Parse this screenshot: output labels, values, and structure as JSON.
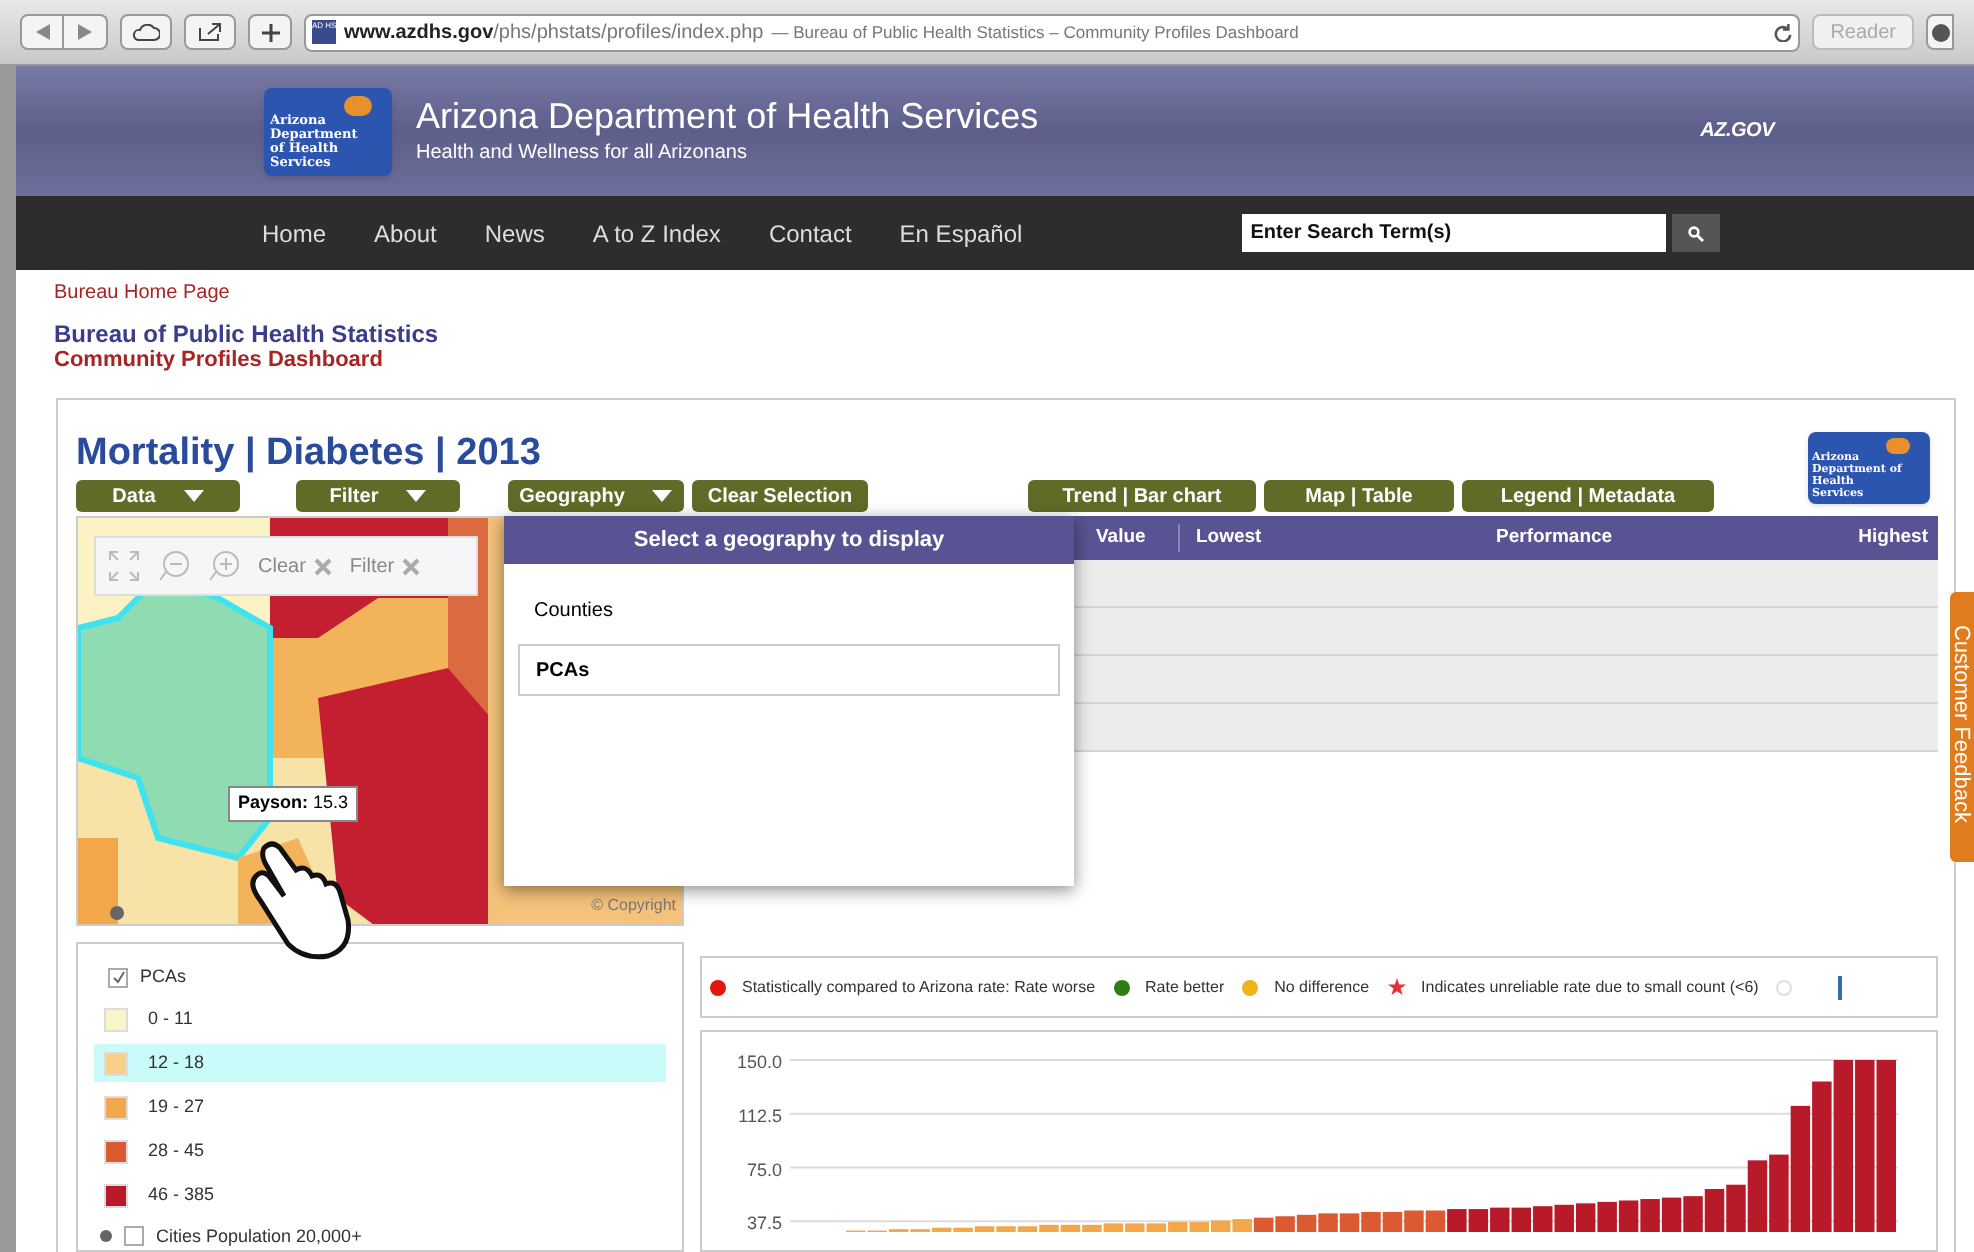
{
  "browser": {
    "url_host": "www.azdhs.gov",
    "url_path": "/phs/phstats/profiles/index.php",
    "page_title": "— Bureau of Public Health Statistics – Community Profiles Dashboard",
    "favicon": "AD HS",
    "reader": "Reader"
  },
  "header": {
    "logo_text": "Arizona Department of Health Services",
    "title": "Arizona Department of Health Services",
    "subtitle": "Health and Wellness for all Arizonans",
    "az_logo": "AZ.GOV"
  },
  "nav": {
    "items": [
      "Home",
      "About",
      "News",
      "A to Z Index",
      "Contact",
      "En Español"
    ],
    "search": {
      "placeholder": "Enter Search Term(s)"
    }
  },
  "breadcrumb": "Bureau Home Page",
  "bureau_title": "Bureau of Public Health Statistics",
  "dashboard_title": "Community Profiles Dashboard",
  "page_heading": "Mortality | Diabetes | 2013",
  "logo_small": "Arizona Department of Health Services",
  "left_buttons": [
    {
      "label": "Data",
      "kind": "dropdown"
    },
    {
      "label": "Filter",
      "kind": "dropdown"
    },
    {
      "label": "Geography",
      "kind": "dropdown"
    },
    {
      "label": "Clear Selection",
      "kind": "plain"
    }
  ],
  "right_buttons": [
    "Trend | Bar chart",
    "Map | Table",
    "Legend | Metadata"
  ],
  "map_tools": {
    "clear": "Clear",
    "filter": "Filter",
    "copyright": "© Copyright",
    "tooltip_name": "Payson:",
    "tooltip_value": "15.3"
  },
  "geography_panel": {
    "title": "Select a geography to display",
    "options": [
      {
        "label": "Counties",
        "selected": false
      },
      {
        "label": "PCAs",
        "selected": true
      }
    ]
  },
  "table": {
    "columns": [
      "Value",
      "Lowest",
      "Performance",
      "Highest"
    ]
  },
  "layer_legend": {
    "layer": {
      "label": "PCAs",
      "checked": true
    },
    "items": [
      {
        "label": "0 - 11",
        "color": "#fbf6c8",
        "selected": false
      },
      {
        "label": "12 - 18",
        "color": "#f7cf86",
        "selected": true
      },
      {
        "label": "19 - 27",
        "color": "#f2a84a",
        "selected": false
      },
      {
        "label": "28 - 45",
        "color": "#dc5a32",
        "selected": false
      },
      {
        "label": "46 - 385",
        "color": "#b81a2a",
        "selected": false
      }
    ],
    "cities": {
      "label": "Cities Population 20,000+",
      "checked": false
    }
  },
  "stat_legend": [
    {
      "label": "Statistically compared to Arizona rate: Rate worse",
      "kind": "dot",
      "color": "#e3170d"
    },
    {
      "label": "Rate better",
      "kind": "dot",
      "color": "#2e7d12"
    },
    {
      "label": "No difference",
      "kind": "dot",
      "color": "#f2b21a"
    },
    {
      "label": "Indicates unreliable rate due to small count (<6)",
      "kind": "star",
      "color": "#e8303a"
    }
  ],
  "feedback": "Customer Feedback",
  "chart_data": {
    "type": "bar",
    "grid": true,
    "ylim": [
      30,
      150
    ],
    "yticks": [
      {
        "value": 37.5,
        "label": "37.5"
      },
      {
        "value": 75,
        "label": "75.0"
      },
      {
        "value": 112.5,
        "label": "112.5"
      },
      {
        "value": 150,
        "label": "150.0"
      }
    ],
    "values": [
      31,
      31,
      32,
      32,
      33,
      33,
      34,
      34,
      34,
      35,
      35,
      35,
      36,
      36,
      36,
      37,
      37,
      38,
      39,
      40,
      41,
      42,
      43,
      43,
      44,
      44,
      45,
      45,
      46,
      46,
      47,
      47,
      48,
      49,
      50,
      51,
      52,
      53,
      54,
      55,
      60,
      63,
      80,
      84,
      118,
      135,
      150,
      150,
      150
    ]
  }
}
